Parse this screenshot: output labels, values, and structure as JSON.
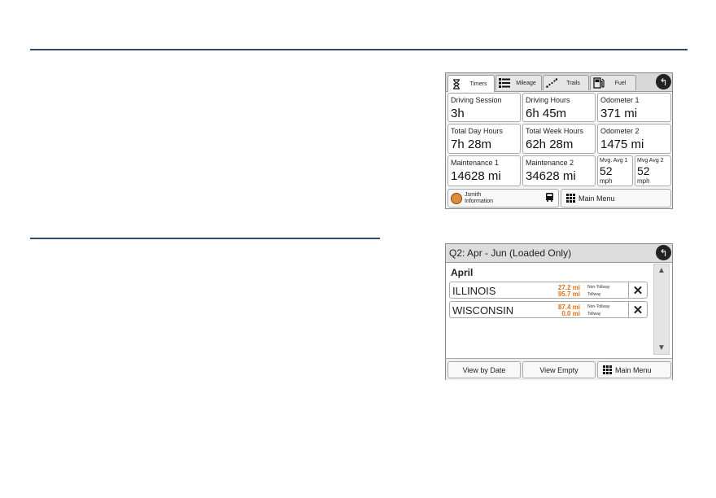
{
  "screen1": {
    "tabs": [
      {
        "label": "Timers",
        "icon": "hourglass-icon"
      },
      {
        "label": "Mileage",
        "icon": "list-icon"
      },
      {
        "label": "Trails",
        "icon": "trail-icon"
      },
      {
        "label": "Fuel",
        "icon": "fuel-pump-icon"
      }
    ],
    "cells": [
      {
        "label": "Driving Session",
        "value": "3h"
      },
      {
        "label": "Driving Hours",
        "value": "6h 45m"
      },
      {
        "label": "Odometer 1",
        "value": "371 mi"
      },
      {
        "label": "Total Day Hours",
        "value": "7h 28m"
      },
      {
        "label": "Total Week Hours",
        "value": "62h 28m"
      },
      {
        "label": "Odometer 2",
        "value": "1475 mi"
      },
      {
        "label": "Maintenance 1",
        "value": "14628 mi"
      },
      {
        "label": "Maintenance 2",
        "value": "34628 mi"
      }
    ],
    "mvg": [
      {
        "label": "Mvg. Avg 1",
        "value": "52",
        "unit": "mph"
      },
      {
        "label": "Mvg Avg 2",
        "value": "52",
        "unit": "mph"
      }
    ],
    "user": {
      "name": "Jsmith",
      "sub": "Information"
    },
    "main_menu": "Main Menu"
  },
  "screen2": {
    "title": "Q2: Apr - Jun (Loaded Only)",
    "month": "April",
    "rows": [
      {
        "state": "ILLINOIS",
        "mi1": "27.2 mi",
        "mi2": "95.7 mi",
        "t1": "Non-Tollway",
        "t2": "Tollway"
      },
      {
        "state": "WISCONSIN",
        "mi1": "87.4 mi",
        "mi2": "0.0 mi",
        "t1": "Non-Tollway",
        "t2": "Tollway"
      }
    ],
    "buttons": {
      "view_date": "View by Date",
      "view_empty": "View Empty",
      "main_menu": "Main Menu"
    }
  },
  "colors": {
    "rule": "#2d4a6a",
    "miles": "#e0701a"
  }
}
